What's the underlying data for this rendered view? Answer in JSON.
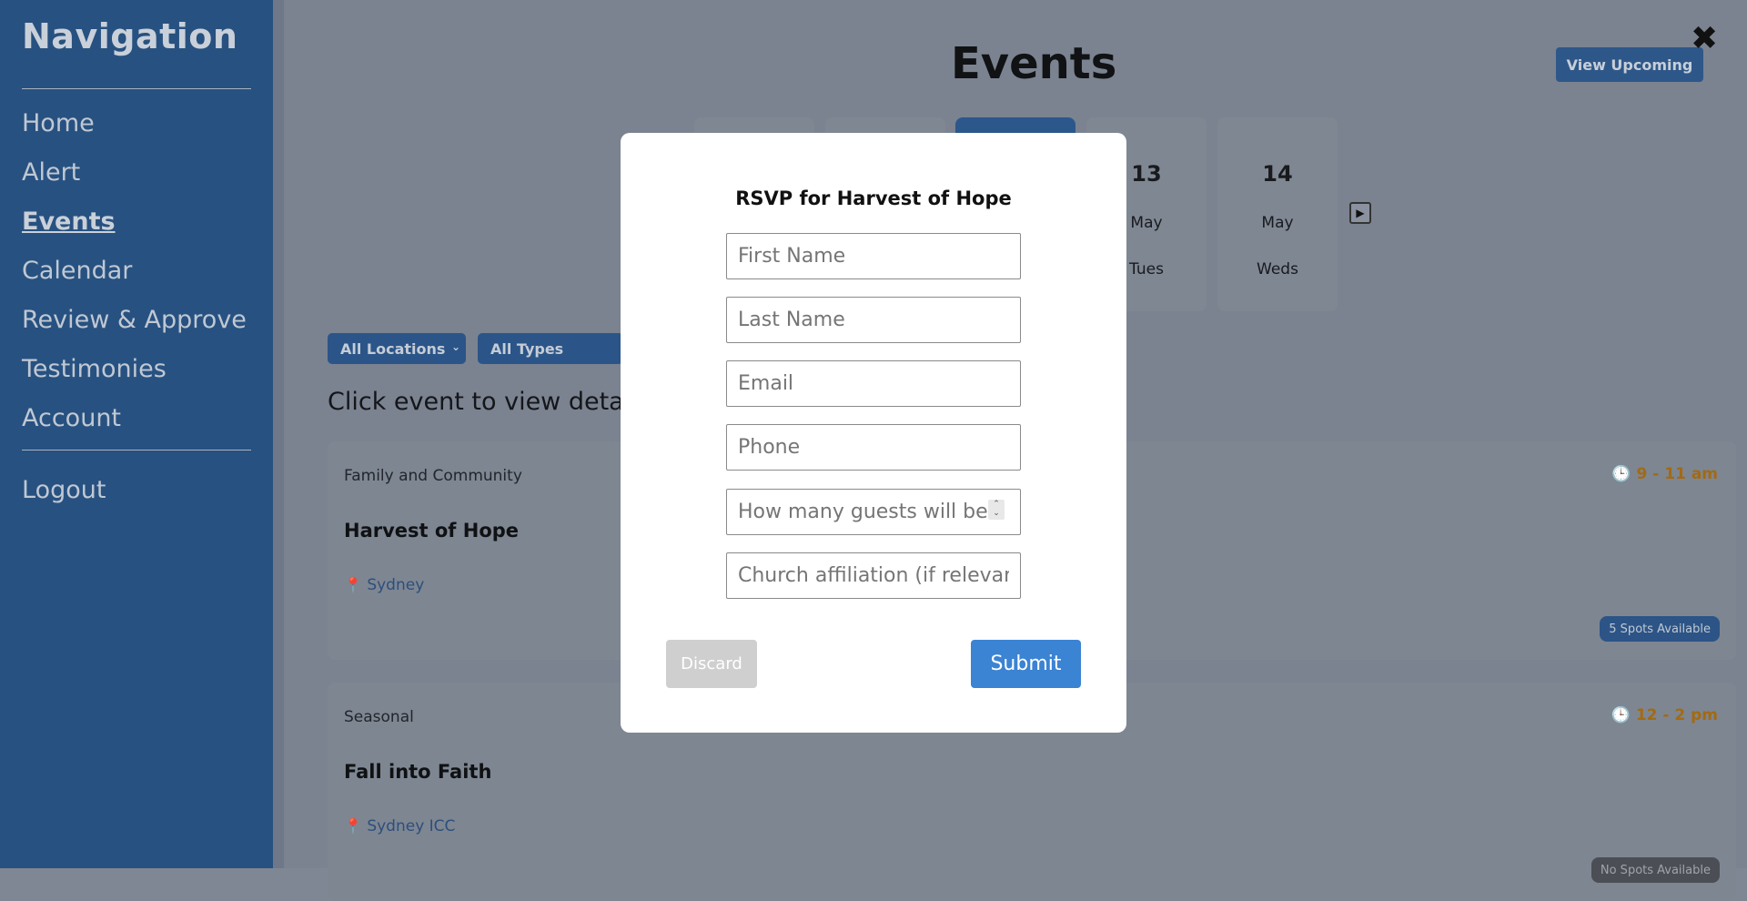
{
  "sidebar": {
    "title": "Navigation",
    "items": [
      {
        "label": "Home"
      },
      {
        "label": "Alert"
      },
      {
        "label": "Events"
      },
      {
        "label": "Calendar"
      },
      {
        "label": "Review & Approve"
      },
      {
        "label": "Testimonies"
      },
      {
        "label": "Account"
      }
    ],
    "logout_label": "Logout",
    "active_item": "Events"
  },
  "header": {
    "title": "Events",
    "view_upcoming_label": "View Upcoming",
    "close_icon": "close-icon"
  },
  "days": [
    {
      "num": "",
      "month": "",
      "weekday": ""
    },
    {
      "num": "",
      "month": "",
      "weekday": ""
    },
    {
      "num": "",
      "month": "",
      "weekday": ""
    },
    {
      "num": "13",
      "month": "May",
      "weekday": "Tues"
    },
    {
      "num": "14",
      "month": "May",
      "weekday": "Weds"
    }
  ],
  "filters": {
    "location": "All Locations",
    "type": "All Types"
  },
  "instruction": "Click event to view details",
  "events": [
    {
      "category": "Family and Community",
      "name": "Harvest of Hope",
      "location": "Sydney",
      "time": "9 - 11 am",
      "badge": "5 Spots Available"
    },
    {
      "category": "Seasonal",
      "name": "Fall into Faith",
      "location": "Sydney ICC",
      "time": "12 - 2 pm",
      "badge": "No Spots Available"
    }
  ],
  "modal": {
    "title": "RSVP for Harvest of Hope",
    "fields": {
      "first_name_placeholder": "First Name",
      "last_name_placeholder": "Last Name",
      "email_placeholder": "Email",
      "phone_placeholder": "Phone",
      "guests_placeholder": "How many guests will be joining?",
      "church_placeholder": "Church affiliation (if relevant)"
    },
    "discard_label": "Discard",
    "submit_label": "Submit"
  },
  "colors": {
    "sidebar_bg": "#275180",
    "accent": "#3b83d3",
    "time_color": "#a36a12"
  }
}
